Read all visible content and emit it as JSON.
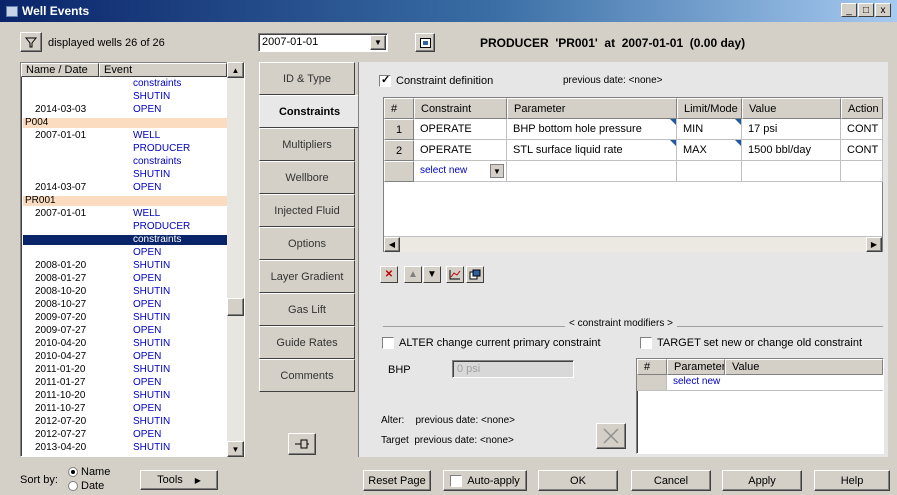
{
  "window": {
    "title": "Well Events",
    "min": "_",
    "max": "□",
    "close": "x"
  },
  "toolbar": {
    "filter_label": "displayed wells 26 of 26",
    "date_value": "2007-01-01",
    "status": "PRODUCER  'PR001'  at  2007-01-01  (0.00 day)"
  },
  "list": {
    "headers": [
      "Name / Date",
      "Event"
    ],
    "rows": [
      {
        "date": "",
        "event": "constraints"
      },
      {
        "date": "",
        "event": "SHUTIN"
      },
      {
        "date": "2014-03-03",
        "event": "OPEN"
      },
      {
        "well": "P004"
      },
      {
        "date": "2007-01-01",
        "event": "WELL"
      },
      {
        "date": "",
        "event": "PRODUCER"
      },
      {
        "date": "",
        "event": "constraints"
      },
      {
        "date": "",
        "event": "SHUTIN"
      },
      {
        "date": "2014-03-07",
        "event": "OPEN"
      },
      {
        "well": "PR001"
      },
      {
        "date": "2007-01-01",
        "event": "WELL"
      },
      {
        "date": "",
        "event": "PRODUCER"
      },
      {
        "date": "",
        "event": "constraints",
        "selected": true
      },
      {
        "date": "",
        "event": "OPEN"
      },
      {
        "date": "2008-01-20",
        "event": "SHUTIN"
      },
      {
        "date": "2008-01-27",
        "event": "OPEN"
      },
      {
        "date": "2008-10-20",
        "event": "SHUTIN"
      },
      {
        "date": "2008-10-27",
        "event": "OPEN"
      },
      {
        "date": "2009-07-20",
        "event": "SHUTIN"
      },
      {
        "date": "2009-07-27",
        "event": "OPEN"
      },
      {
        "date": "2010-04-20",
        "event": "SHUTIN"
      },
      {
        "date": "2010-04-27",
        "event": "OPEN"
      },
      {
        "date": "2011-01-20",
        "event": "SHUTIN"
      },
      {
        "date": "2011-01-27",
        "event": "OPEN"
      },
      {
        "date": "2011-10-20",
        "event": "SHUTIN"
      },
      {
        "date": "2011-10-27",
        "event": "OPEN"
      },
      {
        "date": "2012-07-20",
        "event": "SHUTIN"
      },
      {
        "date": "2012-07-27",
        "event": "OPEN"
      },
      {
        "date": "2013-04-20",
        "event": "SHUTIN"
      }
    ]
  },
  "sort": {
    "label": "Sort by:",
    "name": "Name",
    "date": "Date",
    "tools": "Tools"
  },
  "tabs": [
    "ID & Type",
    "Constraints",
    "Multipliers",
    "Wellbore",
    "Injected Fluid",
    "Options",
    "Layer Gradient",
    "Gas Lift",
    "Guide Rates",
    "Comments"
  ],
  "constraint": {
    "checkbox_label": "Constraint definition",
    "previous_date": "previous date: <none>",
    "headers": [
      "#",
      "Constraint",
      "Parameter",
      "Limit/Mode",
      "Value",
      "Action"
    ],
    "rows": [
      {
        "num": "1",
        "constraint": "OPERATE",
        "parameter": "BHP bottom hole pressure",
        "limit": "MIN",
        "value": "17  psi",
        "action": "CONT"
      },
      {
        "num": "2",
        "constraint": "OPERATE",
        "parameter": "STL surface liquid rate",
        "limit": "MAX",
        "value": "1500  bbl/day",
        "action": "CONT"
      }
    ],
    "select_new": "select new"
  },
  "modifiers": {
    "title": "< constraint modifiers >",
    "alter_label": "ALTER change current primary constraint",
    "target_label": "TARGET set new or change old constraint",
    "bhp_label": "BHP",
    "bhp_placeholder": "0  psi",
    "headers": [
      "#",
      "Parameter",
      "Value"
    ],
    "select_new": "select new",
    "alter_prev": "Alter:    previous date: <none>",
    "target_prev": "Target  previous date: <none>"
  },
  "footer": {
    "reset": "Reset Page",
    "auto_apply": "Auto-apply",
    "ok": "OK",
    "cancel": "Cancel",
    "apply": "Apply",
    "help": "Help"
  }
}
